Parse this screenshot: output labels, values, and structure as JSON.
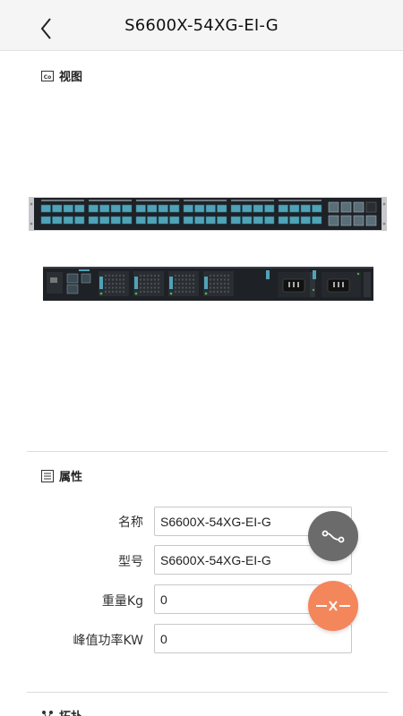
{
  "header": {
    "title": "S6600X-54XG-EI-G"
  },
  "view_section": {
    "title": "视图"
  },
  "props_section": {
    "title": "属性",
    "fields": [
      {
        "label": "名称",
        "value": "S6600X-54XG-EI-G"
      },
      {
        "label": "型号",
        "value": "S6600X-54XG-EI-G"
      },
      {
        "label": "重量Kg",
        "value": "0"
      },
      {
        "label": "峰值功率KW",
        "value": "0"
      }
    ]
  },
  "topo_section": {
    "title": "拓扑"
  },
  "colors": {
    "navbar_bg": "#f5f5f5",
    "fab_gray": "#6b6b6b",
    "fab_orange": "#f4865c",
    "port_teal": "#4fa3b8",
    "chassis": "#1e2126"
  },
  "icons": {
    "back": "chevron-left-icon",
    "view": "image-icon",
    "props": "list-icon",
    "topo": "topology-icon",
    "fab_topo": "connect-icon",
    "fab_disconnect": "disconnect-icon"
  }
}
